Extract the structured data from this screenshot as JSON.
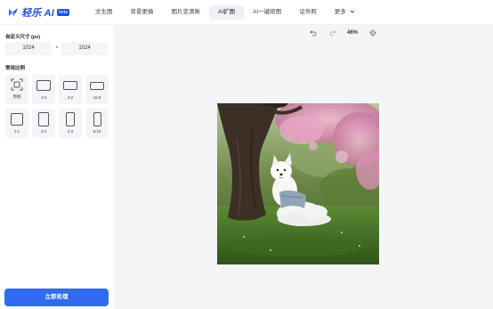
{
  "brand": {
    "name": "轻乐 AI",
    "badge": "beta",
    "color": "#1f4fe0"
  },
  "nav": {
    "items": [
      {
        "label": "文生图",
        "active": false
      },
      {
        "label": "背景更换",
        "active": false
      },
      {
        "label": "图片变清晰",
        "active": false
      },
      {
        "label": "AI扩图",
        "active": true
      },
      {
        "label": "AI一键抠图",
        "active": false
      },
      {
        "label": "证件照",
        "active": false
      },
      {
        "label": "更多",
        "active": false
      }
    ]
  },
  "sidebar": {
    "custom_size_title": "自定义尺寸 (px)",
    "width_value": "1024",
    "height_value": "1024",
    "times_sign": "×",
    "ratios_title": "常用比例",
    "ratios": [
      {
        "label": "原图",
        "icon": "original-icon"
      },
      {
        "label": "4:3",
        "icon": "ratio-4-3-icon"
      },
      {
        "label": "3:2",
        "icon": "ratio-3-2-icon"
      },
      {
        "label": "16:9",
        "icon": "ratio-16-9-icon"
      },
      {
        "label": "1:1",
        "icon": "ratio-1-1-icon"
      },
      {
        "label": "3:4",
        "icon": "ratio-3-4-icon"
      },
      {
        "label": "2:3",
        "icon": "ratio-2-3-icon"
      },
      {
        "label": "9:16",
        "icon": "ratio-9-16-icon"
      }
    ],
    "process_button": "立即处理",
    "accent": "#2f6bf3"
  },
  "toolbar": {
    "undo_icon": "undo-icon",
    "redo_icon": "redo-icon",
    "zoom": "46%",
    "fit_icon": "target-icon"
  },
  "canvas": {
    "background": "#f4f5f7",
    "image_subject": "white samoyed dog under a cherry blossom tree"
  }
}
